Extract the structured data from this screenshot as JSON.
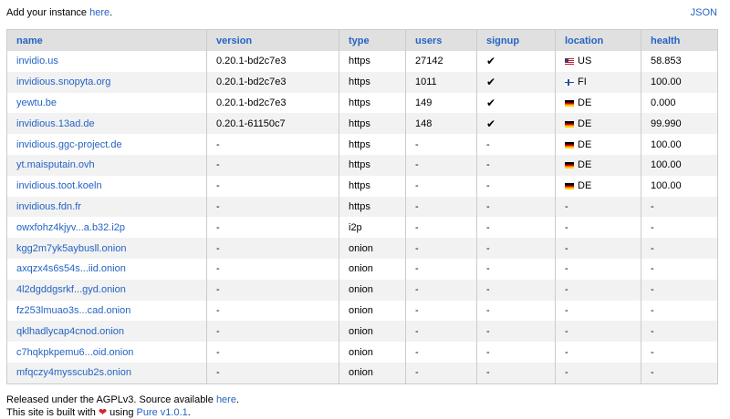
{
  "top": {
    "intro": "Add your instance ",
    "intro_link": "here",
    "intro_end": ".",
    "json_link": "JSON"
  },
  "columns": [
    "name",
    "version",
    "type",
    "users",
    "signup",
    "location",
    "health"
  ],
  "rows": [
    {
      "name": "invidio.us",
      "version": "0.20.1-bd2c7e3",
      "type": "https",
      "users": "27142",
      "signup": "✔",
      "flag": "us",
      "location": "US",
      "health": "58.853"
    },
    {
      "name": "invidious.snopyta.org",
      "version": "0.20.1-bd2c7e3",
      "type": "https",
      "users": "1011",
      "signup": "✔",
      "flag": "fi",
      "location": "FI",
      "health": "100.00"
    },
    {
      "name": "yewtu.be",
      "version": "0.20.1-bd2c7e3",
      "type": "https",
      "users": "149",
      "signup": "✔",
      "flag": "de",
      "location": "DE",
      "health": "0.000"
    },
    {
      "name": "invidious.13ad.de",
      "version": "0.20.1-61150c7",
      "type": "https",
      "users": "148",
      "signup": "✔",
      "flag": "de",
      "location": "DE",
      "health": "99.990"
    },
    {
      "name": "invidious.ggc-project.de",
      "version": "-",
      "type": "https",
      "users": "-",
      "signup": "-",
      "flag": "de",
      "location": "DE",
      "health": "100.00"
    },
    {
      "name": "yt.maisputain.ovh",
      "version": "-",
      "type": "https",
      "users": "-",
      "signup": "-",
      "flag": "de",
      "location": "DE",
      "health": "100.00"
    },
    {
      "name": "invidious.toot.koeln",
      "version": "-",
      "type": "https",
      "users": "-",
      "signup": "-",
      "flag": "de",
      "location": "DE",
      "health": "100.00"
    },
    {
      "name": "invidious.fdn.fr",
      "version": "-",
      "type": "https",
      "users": "-",
      "signup": "-",
      "flag": "",
      "location": "-",
      "health": "-"
    },
    {
      "name": "owxfohz4kjyv...a.b32.i2p",
      "version": "-",
      "type": "i2p",
      "users": "-",
      "signup": "-",
      "flag": "",
      "location": "-",
      "health": "-"
    },
    {
      "name": "kgg2m7yk5aybusll.onion",
      "version": "-",
      "type": "onion",
      "users": "-",
      "signup": "-",
      "flag": "",
      "location": "-",
      "health": "-"
    },
    {
      "name": "axqzx4s6s54s...iid.onion",
      "version": "-",
      "type": "onion",
      "users": "-",
      "signup": "-",
      "flag": "",
      "location": "-",
      "health": "-"
    },
    {
      "name": "4l2dgddgsrkf...gyd.onion",
      "version": "-",
      "type": "onion",
      "users": "-",
      "signup": "-",
      "flag": "",
      "location": "-",
      "health": "-"
    },
    {
      "name": "fz253lmuao3s...cad.onion",
      "version": "-",
      "type": "onion",
      "users": "-",
      "signup": "-",
      "flag": "",
      "location": "-",
      "health": "-"
    },
    {
      "name": "qklhadlycap4cnod.onion",
      "version": "-",
      "type": "onion",
      "users": "-",
      "signup": "-",
      "flag": "",
      "location": "-",
      "health": "-"
    },
    {
      "name": "c7hqkpkpemu6...oid.onion",
      "version": "-",
      "type": "onion",
      "users": "-",
      "signup": "-",
      "flag": "",
      "location": "-",
      "health": "-"
    },
    {
      "name": "mfqczy4mysscub2s.onion",
      "version": "-",
      "type": "onion",
      "users": "-",
      "signup": "-",
      "flag": "",
      "location": "-",
      "health": "-"
    }
  ],
  "footer": {
    "line1_text": "Released under the AGPLv3. Source available ",
    "line1_link": "here",
    "line1_end": ".",
    "line2_text": "This site is built with ",
    "heart": "❤",
    "line2_mid": " using ",
    "line2_link": "Pure v1.0.1",
    "line2_end": "."
  }
}
